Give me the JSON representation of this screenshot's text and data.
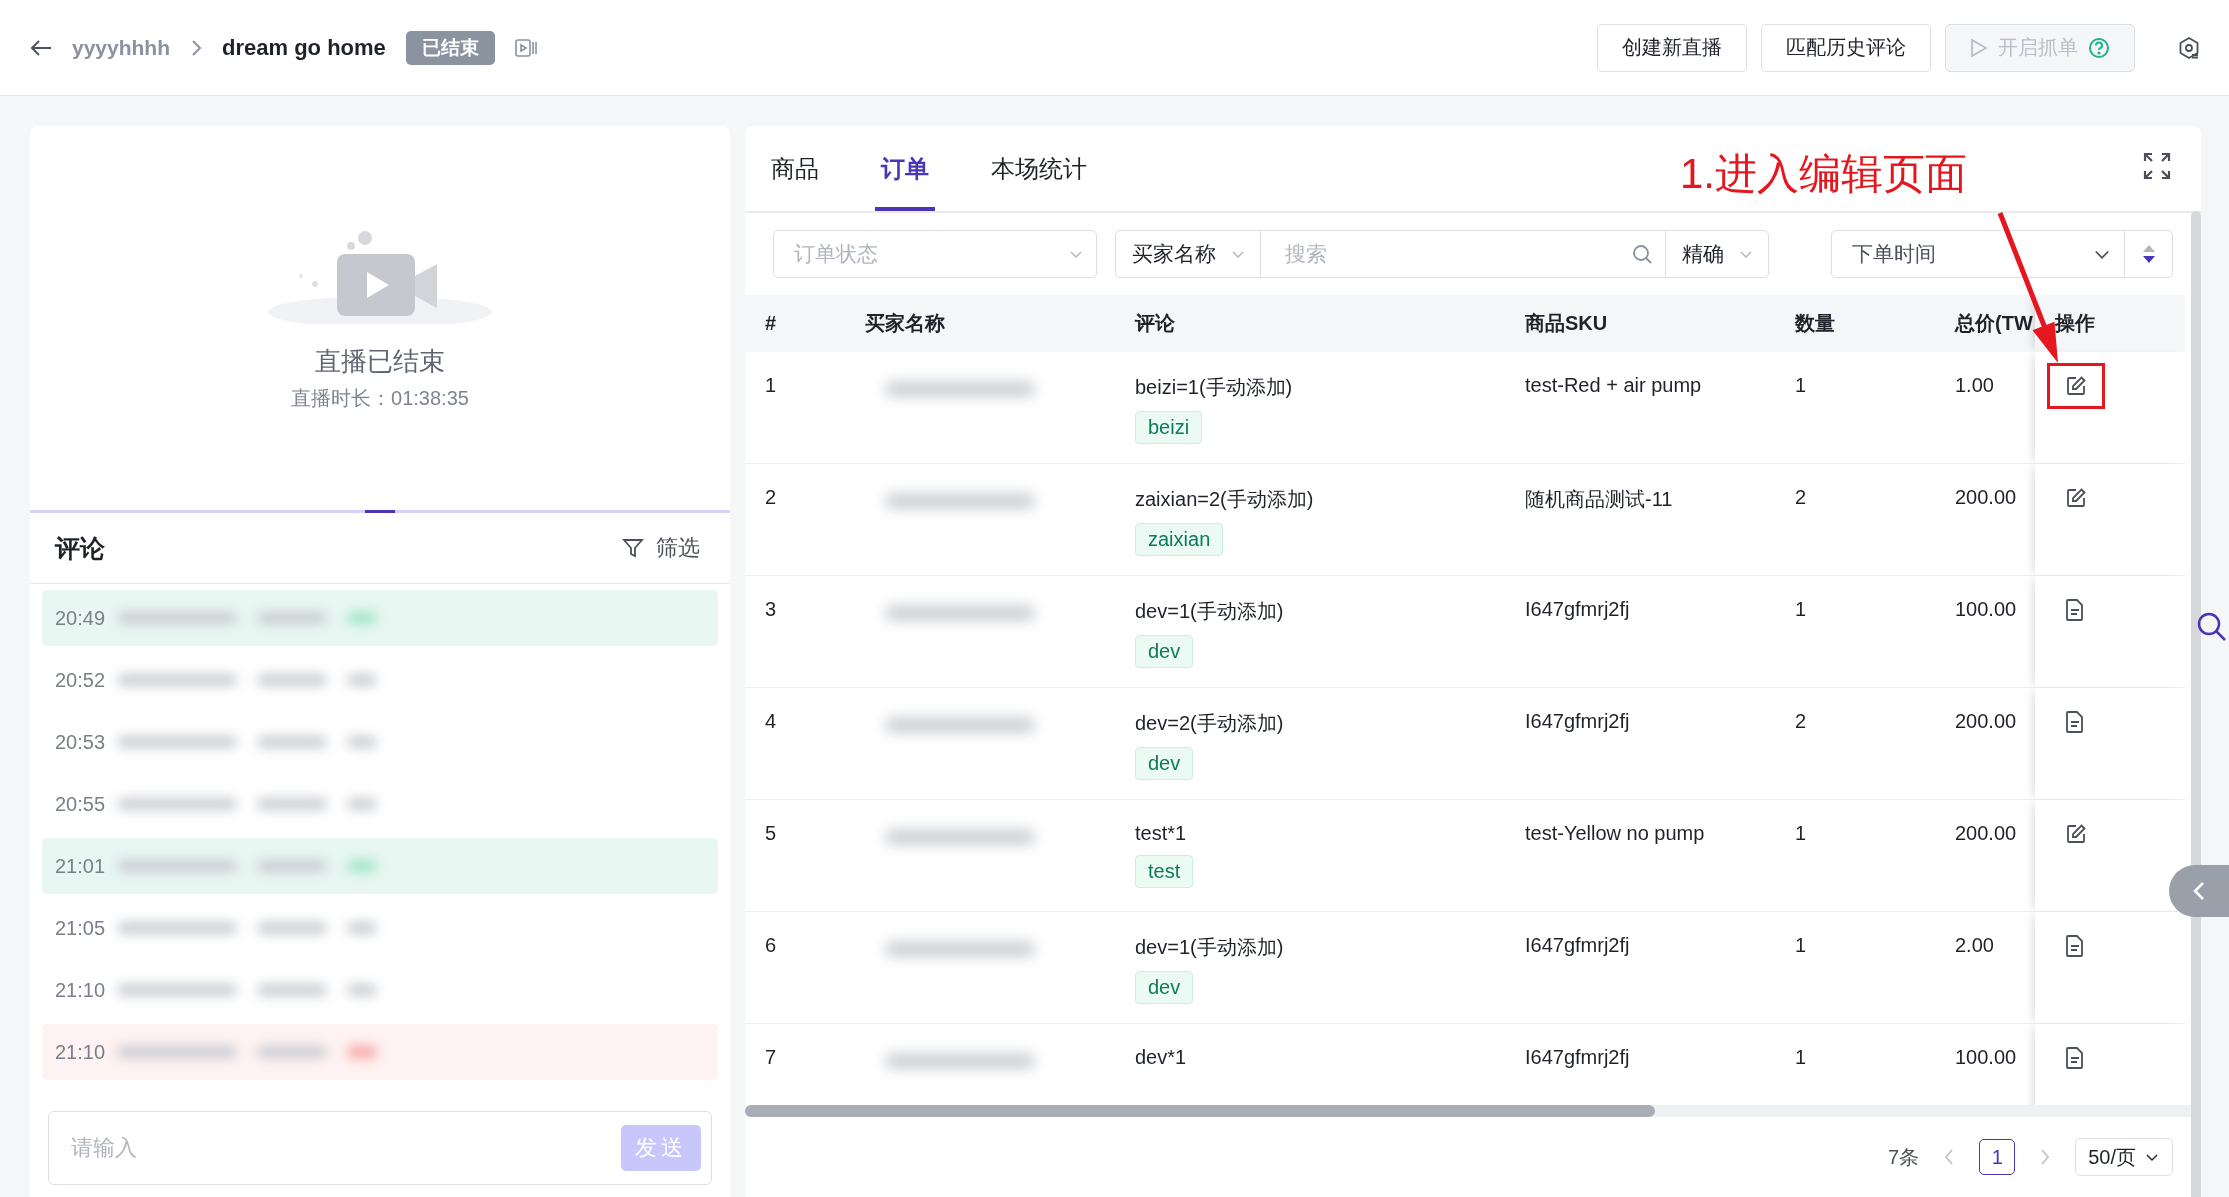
{
  "header": {
    "breadcrumb_parent": "yyyyhhhh",
    "title": "dream go home",
    "status": "已结束",
    "buttons": [
      {
        "label": "创建新直播",
        "disabled": false,
        "help": false
      },
      {
        "label": "匹配历史评论",
        "disabled": false,
        "help": false
      },
      {
        "label": "开启抓单",
        "disabled": true,
        "help": true
      }
    ]
  },
  "live": {
    "message": "直播已结束",
    "duration": "直播时长：01:38:35"
  },
  "comments": {
    "title": "评论",
    "filter": "筛选",
    "rows": [
      {
        "time": "20:49",
        "kind": "success"
      },
      {
        "time": "20:52",
        "kind": "normal"
      },
      {
        "time": "20:53",
        "kind": "normal"
      },
      {
        "time": "20:55",
        "kind": "normal"
      },
      {
        "time": "21:01",
        "kind": "success"
      },
      {
        "time": "21:05",
        "kind": "normal"
      },
      {
        "time": "21:10",
        "kind": "normal"
      },
      {
        "time": "21:10",
        "kind": "error"
      }
    ],
    "input": {
      "placeholder": "请输入"
    },
    "send": "发送"
  },
  "tabs": [
    {
      "label": "商品",
      "selected": false
    },
    {
      "label": "订单",
      "selected": true
    },
    {
      "label": "本场统计",
      "selected": false
    }
  ],
  "filters": {
    "status": {
      "placeholder": "订单状态"
    },
    "field": "买家名称",
    "search": {
      "placeholder": "搜索"
    },
    "match": "精确",
    "sort": {
      "placeholder": "下单时间"
    }
  },
  "annotation": {
    "text": "1.进入编辑页面"
  },
  "table": {
    "columns": [
      "#",
      "买家名称",
      "评论",
      "商品SKU",
      "数量",
      "总价(TW",
      "操作"
    ],
    "rows": [
      {
        "index": "1",
        "comment": "beizi=1(手动添加)",
        "tag": "beizi",
        "sku": "test-Red + air pump",
        "qty": "1",
        "total": "1.00",
        "kind": "edit",
        "highlighted": true
      },
      {
        "index": "2",
        "comment": "zaixian=2(手动添加)",
        "tag": "zaixian",
        "sku": "随机商品测试-11",
        "qty": "2",
        "total": "200.00",
        "kind": "edit",
        "highlighted": false
      },
      {
        "index": "3",
        "comment": "dev=1(手动添加)",
        "tag": "dev",
        "sku": "I647gfmrj2fj",
        "qty": "1",
        "total": "100.00",
        "kind": "document",
        "highlighted": false
      },
      {
        "index": "4",
        "comment": "dev=2(手动添加)",
        "tag": "dev",
        "sku": "I647gfmrj2fj",
        "qty": "2",
        "total": "200.00",
        "kind": "document",
        "highlighted": false
      },
      {
        "index": "5",
        "comment": "test*1",
        "tag": "test",
        "sku": "test-Yellow no pump",
        "qty": "1",
        "total": "200.00",
        "kind": "edit",
        "highlighted": false
      },
      {
        "index": "6",
        "comment": "dev=1(手动添加)",
        "tag": "dev",
        "sku": "I647gfmrj2fj",
        "qty": "1",
        "total": "2.00",
        "kind": "document",
        "highlighted": false
      },
      {
        "index": "7",
        "comment": "dev*1",
        "sku": "I647gfmrj2fj",
        "qty": "1",
        "total": "100.00",
        "kind": "document",
        "highlighted": false
      }
    ]
  },
  "pagination": {
    "total": "7条",
    "pages": [
      {
        "label": "1",
        "selected": true
      }
    ],
    "page_size": "50/页"
  }
}
